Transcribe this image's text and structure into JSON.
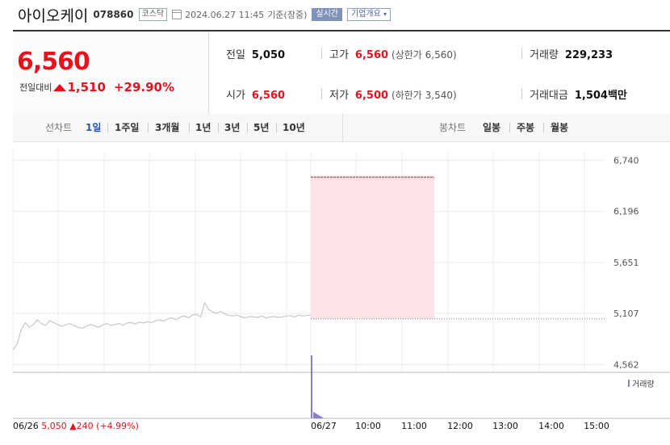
{
  "header": {
    "name": "아이오케이",
    "code": "078860",
    "market": "코스닥",
    "datetime": "2024.06.27 11:45",
    "basis": "기준(장중)",
    "realtime_button": "실시간",
    "company_info_button": "기업개요",
    "company_info_arrow": "▾"
  },
  "summary": {
    "current_price": "6,560",
    "change_label": "전일대비",
    "change_amount": "1,510",
    "change_rate": "+29.90%",
    "prev_close_label": "전일",
    "prev_close": "5,050",
    "open_label": "시가",
    "open": "6,560",
    "high_label": "고가",
    "high": "6,560",
    "upper_limit_label": "(상한가 6,560)",
    "low_label": "저가",
    "low": "6,500",
    "lower_limit_label": "(하한가 3,540)",
    "volume_label": "거래량",
    "volume": "229,233",
    "amount_label": "거래대금",
    "amount": "1,504",
    "amount_unit": "백만"
  },
  "period_bar": {
    "line_label": "선차트",
    "line_periods": [
      "1일",
      "1주일",
      "3개월",
      "1년",
      "3년",
      "5년",
      "10년"
    ],
    "candle_label": "봉차트",
    "candle_periods": [
      "일봉",
      "주봉",
      "월봉"
    ]
  },
  "colors": {
    "up": "#e4131e",
    "accent": "#2554b0",
    "price_line": "#c8c8c8",
    "high_line": "#e0454b",
    "fill": "#fde3e5",
    "volume": "#8c7fc6"
  },
  "chart_data": {
    "type": "line",
    "y_ticks": [
      "6,740",
      "6,196",
      "5,651",
      "5,107",
      "4,562"
    ],
    "y_tick_values": [
      6740,
      6196,
      5651,
      5107,
      4562
    ],
    "ylim": [
      4480,
      6830
    ],
    "x_ticks": [
      "06/27",
      "10:00",
      "11:00",
      "12:00",
      "13:00",
      "14:00",
      "15:00"
    ],
    "prev_day_label": "06/26",
    "prev_day_close": "5,050",
    "prev_day_change": "240",
    "prev_day_change_rate": "(+4.99%)",
    "prev_close_value": 5050,
    "volume_legend": "거래량",
    "series": [
      {
        "values": [
          4720,
          4780,
          4930,
          5010,
          4960,
          4990,
          5040,
          5000,
          4980,
          5030,
          5010,
          4990,
          4970,
          4985,
          5000,
          4975,
          4960,
          4950,
          4970,
          4990,
          4975,
          4960,
          4985,
          5000,
          4980,
          4990,
          5000,
          4980,
          5005,
          5010,
          4995,
          5015,
          5005,
          5020,
          5010,
          5030,
          5040,
          5025,
          5050,
          5060,
          5040,
          5070,
          5080,
          5060,
          5090,
          5100,
          5070,
          5220,
          5150,
          5120,
          5110,
          5130,
          5100,
          5085,
          5080,
          5090,
          5070,
          5060,
          5075,
          5070,
          5065,
          5080,
          5060,
          5070,
          5075,
          5065,
          5070,
          5080,
          5085,
          5070,
          5090,
          5080,
          5085,
          5090
        ]
      },
      {
        "values": [
          6560,
          6560
        ]
      }
    ],
    "volume_spike": "06/27 09:00"
  }
}
